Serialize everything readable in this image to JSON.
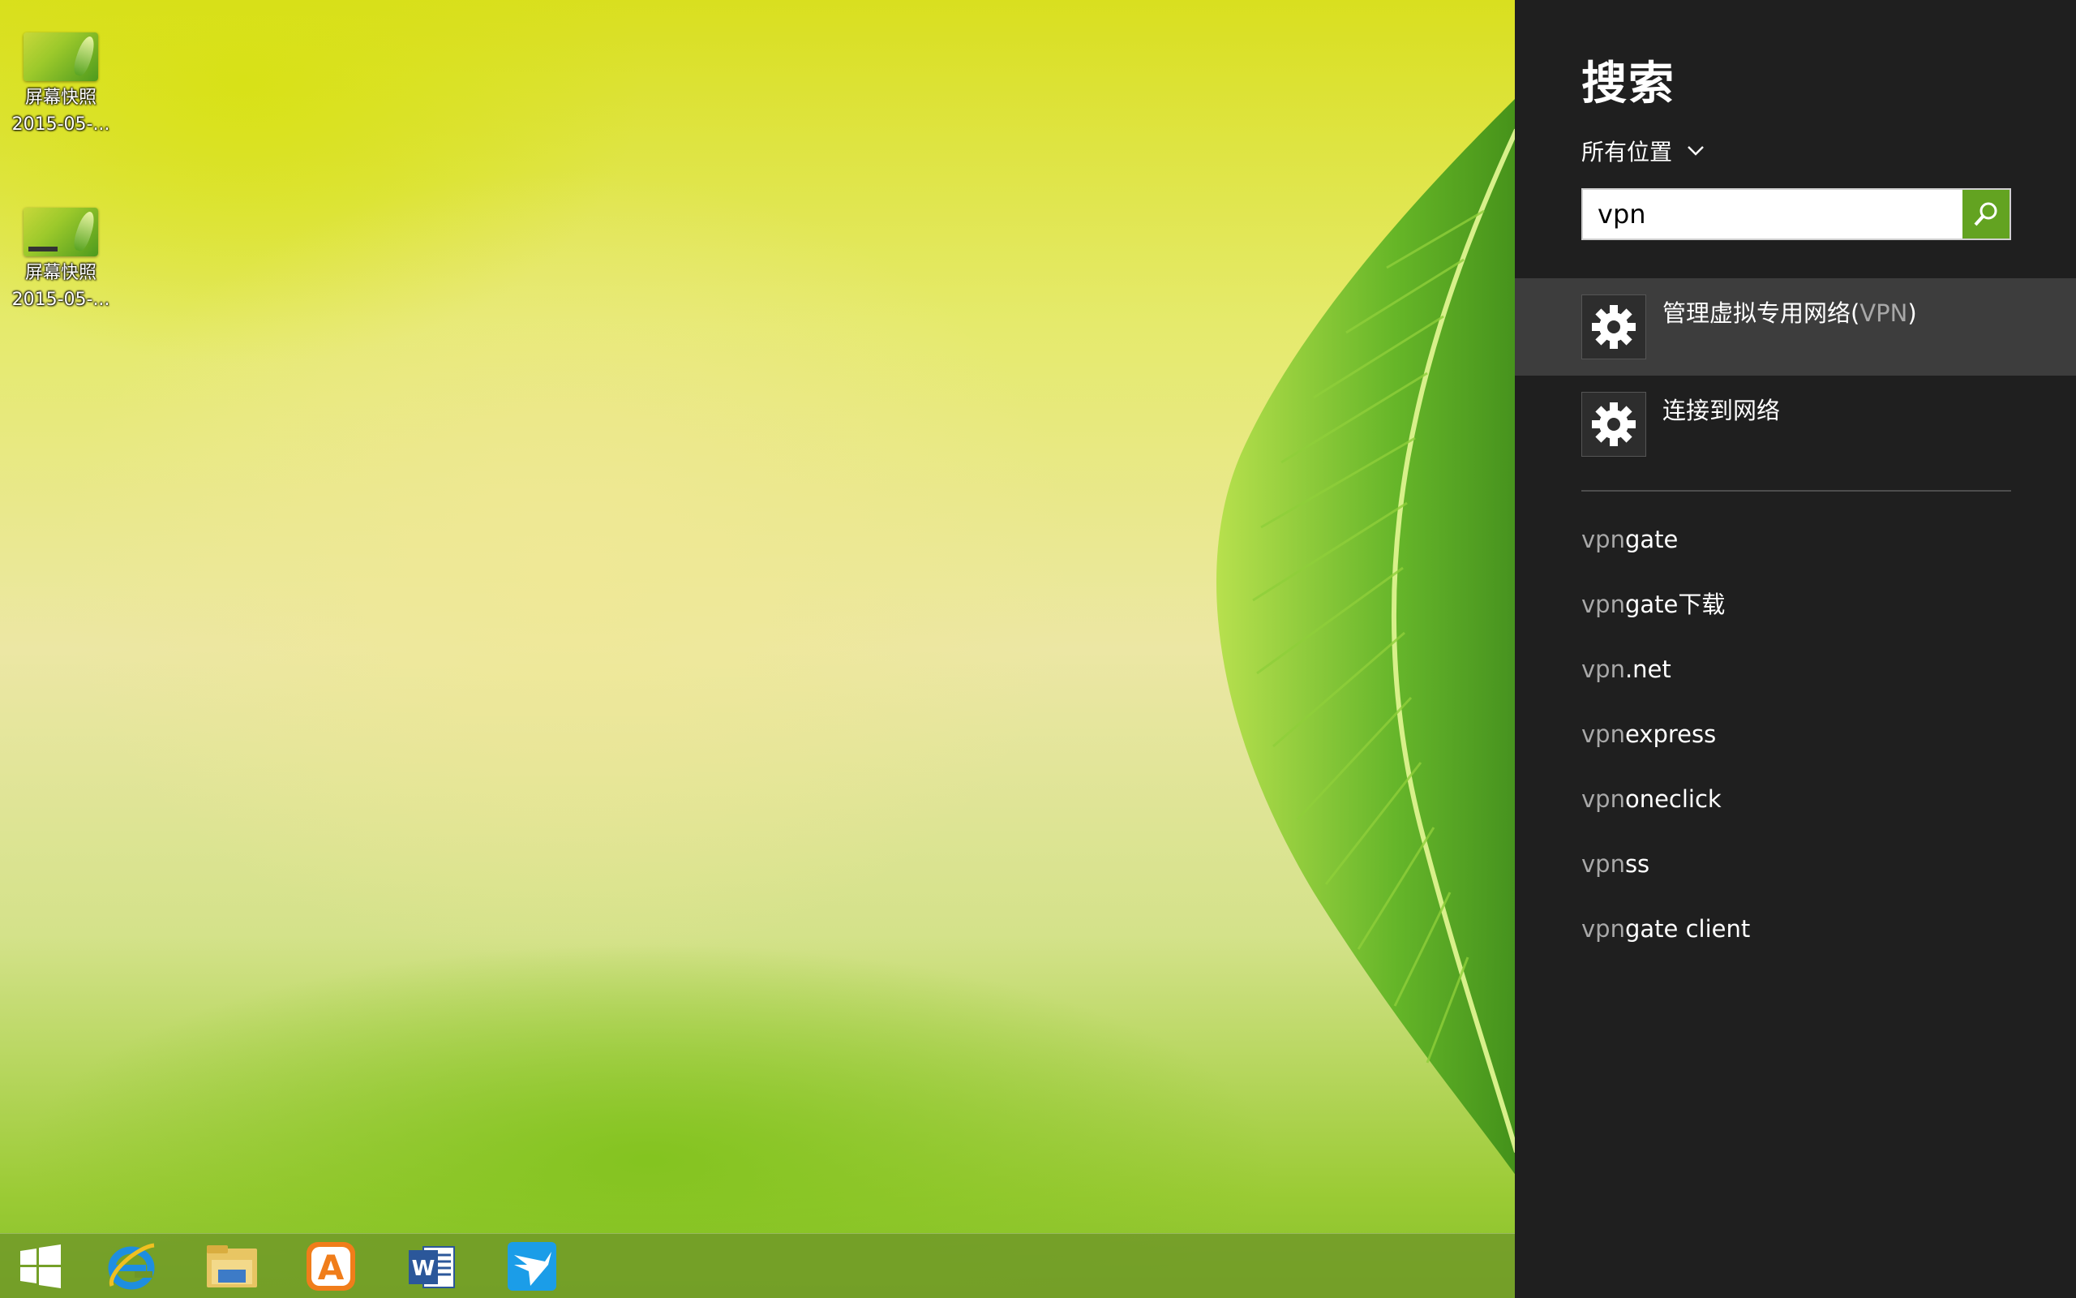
{
  "desktop": {
    "icons": [
      {
        "name": "屏幕快照",
        "date": "2015-05-..."
      },
      {
        "name": "屏幕快照",
        "date": "2015-05-..."
      }
    ]
  },
  "taskbar": {
    "items": [
      "start-icon",
      "internet-explorer-icon",
      "file-explorer-icon",
      "app-store-icon",
      "word-icon",
      "bird-app-icon"
    ]
  },
  "search": {
    "title": "搜索",
    "scope": "所有位置",
    "query": "vpn",
    "accent": "#63a321",
    "results": [
      {
        "text": "管理虚拟专用网络(",
        "highlight": "VPN",
        "suffix": ")"
      },
      {
        "text": "连接到网络"
      }
    ],
    "suggestions": [
      {
        "prefix": "vpn",
        "rest": "gate"
      },
      {
        "prefix": "vpn",
        "rest": "gate下载"
      },
      {
        "prefix": "vpn",
        "rest": ".net"
      },
      {
        "prefix": "vpn",
        "rest": "express"
      },
      {
        "prefix": "vpn",
        "rest": "oneclick"
      },
      {
        "prefix": "vpn",
        "rest": "ss"
      },
      {
        "prefix": "vpn",
        "rest": "gate client"
      }
    ]
  }
}
